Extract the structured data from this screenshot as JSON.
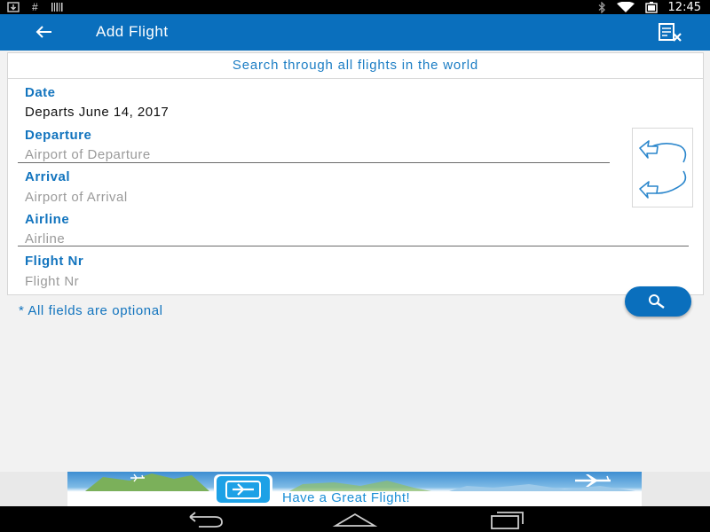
{
  "status_bar": {
    "left_icons": [
      "download-icon",
      "hash-icon",
      "barcode-icon"
    ],
    "right_icons": [
      "bluetooth-icon",
      "wifi-icon",
      "battery-icon"
    ],
    "time": "12:45"
  },
  "appbar": {
    "title": "Add Flight",
    "back_icon": "arrow-left-icon",
    "clear_icon": "clear-form-icon",
    "color": "#0a6fbd"
  },
  "form": {
    "headline": "Search through all flights in the world",
    "date_label": "Date",
    "date_value": "Departs June 14, 2017",
    "departure_label": "Departure",
    "departure_placeholder": "Airport of Departure",
    "arrival_label": "Arrival",
    "arrival_placeholder": "Airport of Arrival",
    "airline_label": "Airline",
    "airline_placeholder": "Airline",
    "flight_nr_label": "Flight Nr",
    "flight_nr_placeholder": "Flight Nr",
    "swap_icon": "swap-airports-icon",
    "note": "* All fields are optional"
  },
  "fab": {
    "icon": "search-icon"
  },
  "ad": {
    "text": "Have a Great Flight!",
    "icon": "airplane-icon"
  },
  "nav_bar": {
    "icons": [
      "back-nav-icon",
      "home-nav-icon",
      "recents-nav-icon"
    ]
  }
}
